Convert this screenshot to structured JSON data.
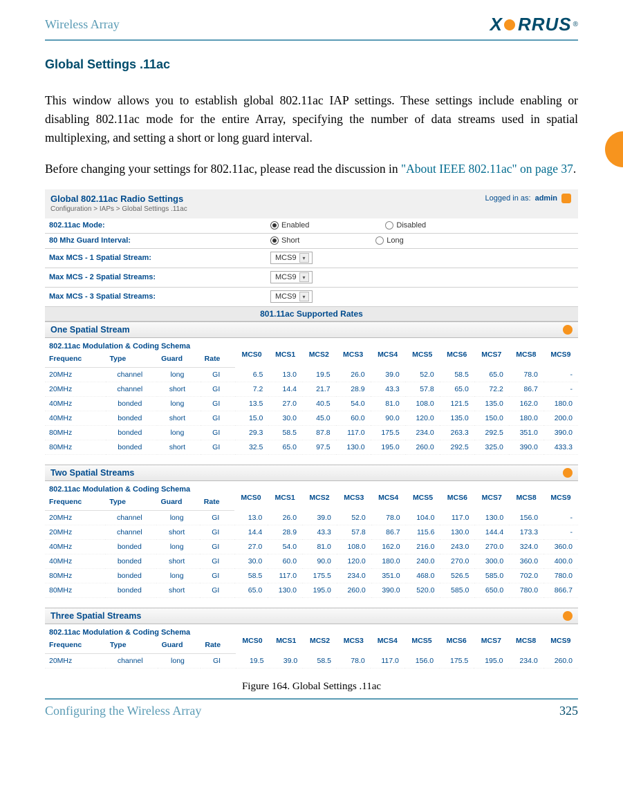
{
  "page": {
    "product_name": "Wireless Array",
    "logo_text": "XIRRUS",
    "section_title": "Global Settings .11ac",
    "para1": "This window allows you to establish global 802.11ac IAP settings. These settings include enabling or disabling 802.11ac mode for the entire Array, specifying the number of data streams used in spatial multiplexing, and setting a short or long guard interval.",
    "para2_pre": "Before changing your settings for 802.11ac, please read the discussion in ",
    "para2_link": "\"About IEEE 802.11ac\" on page 37",
    "para2_post": ".",
    "figure_caption": "Figure 164. Global Settings .11ac",
    "footer_left": "Configuring the Wireless Array",
    "footer_page": "325"
  },
  "panel": {
    "title": "Global 802.11ac Radio Settings",
    "breadcrumb": "Configuration > IAPs > Global Settings .11ac",
    "logged_in_label": "Logged in as:",
    "logged_in_user": "admin",
    "settings": [
      {
        "label": "802.11ac Mode:",
        "type": "radio",
        "opt1": "Enabled",
        "opt2": "Disabled",
        "selected": 1
      },
      {
        "label": "80 Mhz Guard Interval:",
        "type": "radio",
        "opt1": "Short",
        "opt2": "Long",
        "selected": 1
      },
      {
        "label": "Max MCS - 1 Spatial Stream:",
        "type": "select",
        "value": "MCS9"
      },
      {
        "label": "Max MCS - 2 Spatial Streams:",
        "type": "select",
        "value": "MCS9"
      },
      {
        "label": "Max MCS - 3 Spatial Streams:",
        "type": "select",
        "value": "MCS9"
      }
    ],
    "supported_rates_title": "801.11ac Supported Rates",
    "schema_title": "802.11ac Modulation & Coding Schema",
    "row_header_labels": [
      "Frequenc",
      "Type",
      "Guard",
      "Rate"
    ],
    "mcs_headers": [
      "MCS0",
      "MCS1",
      "MCS2",
      "MCS3",
      "MCS4",
      "MCS5",
      "MCS6",
      "MCS7",
      "MCS8",
      "MCS9"
    ],
    "groups": [
      {
        "title": "One Spatial Stream",
        "rows": [
          {
            "freq": "20MHz",
            "type": "channel",
            "guard": "long",
            "rate": "GI",
            "v": [
              "6.5",
              "13.0",
              "19.5",
              "26.0",
              "39.0",
              "52.0",
              "58.5",
              "65.0",
              "78.0",
              "-"
            ]
          },
          {
            "freq": "20MHz",
            "type": "channel",
            "guard": "short",
            "rate": "GI",
            "v": [
              "7.2",
              "14.4",
              "21.7",
              "28.9",
              "43.3",
              "57.8",
              "65.0",
              "72.2",
              "86.7",
              "-"
            ]
          },
          {
            "freq": "40MHz",
            "type": "bonded",
            "guard": "long",
            "rate": "GI",
            "v": [
              "13.5",
              "27.0",
              "40.5",
              "54.0",
              "81.0",
              "108.0",
              "121.5",
              "135.0",
              "162.0",
              "180.0"
            ]
          },
          {
            "freq": "40MHz",
            "type": "bonded",
            "guard": "short",
            "rate": "GI",
            "v": [
              "15.0",
              "30.0",
              "45.0",
              "60.0",
              "90.0",
              "120.0",
              "135.0",
              "150.0",
              "180.0",
              "200.0"
            ]
          },
          {
            "freq": "80MHz",
            "type": "bonded",
            "guard": "long",
            "rate": "GI",
            "v": [
              "29.3",
              "58.5",
              "87.8",
              "117.0",
              "175.5",
              "234.0",
              "263.3",
              "292.5",
              "351.0",
              "390.0"
            ]
          },
          {
            "freq": "80MHz",
            "type": "bonded",
            "guard": "short",
            "rate": "GI",
            "v": [
              "32.5",
              "65.0",
              "97.5",
              "130.0",
              "195.0",
              "260.0",
              "292.5",
              "325.0",
              "390.0",
              "433.3"
            ]
          }
        ]
      },
      {
        "title": "Two Spatial Streams",
        "rows": [
          {
            "freq": "20MHz",
            "type": "channel",
            "guard": "long",
            "rate": "GI",
            "v": [
              "13.0",
              "26.0",
              "39.0",
              "52.0",
              "78.0",
              "104.0",
              "117.0",
              "130.0",
              "156.0",
              "-"
            ]
          },
          {
            "freq": "20MHz",
            "type": "channel",
            "guard": "short",
            "rate": "GI",
            "v": [
              "14.4",
              "28.9",
              "43.3",
              "57.8",
              "86.7",
              "115.6",
              "130.0",
              "144.4",
              "173.3",
              "-"
            ]
          },
          {
            "freq": "40MHz",
            "type": "bonded",
            "guard": "long",
            "rate": "GI",
            "v": [
              "27.0",
              "54.0",
              "81.0",
              "108.0",
              "162.0",
              "216.0",
              "243.0",
              "270.0",
              "324.0",
              "360.0"
            ]
          },
          {
            "freq": "40MHz",
            "type": "bonded",
            "guard": "short",
            "rate": "GI",
            "v": [
              "30.0",
              "60.0",
              "90.0",
              "120.0",
              "180.0",
              "240.0",
              "270.0",
              "300.0",
              "360.0",
              "400.0"
            ]
          },
          {
            "freq": "80MHz",
            "type": "bonded",
            "guard": "long",
            "rate": "GI",
            "v": [
              "58.5",
              "117.0",
              "175.5",
              "234.0",
              "351.0",
              "468.0",
              "526.5",
              "585.0",
              "702.0",
              "780.0"
            ]
          },
          {
            "freq": "80MHz",
            "type": "bonded",
            "guard": "short",
            "rate": "GI",
            "v": [
              "65.0",
              "130.0",
              "195.0",
              "260.0",
              "390.0",
              "520.0",
              "585.0",
              "650.0",
              "780.0",
              "866.7"
            ]
          }
        ]
      },
      {
        "title": "Three Spatial Streams",
        "rows": [
          {
            "freq": "20MHz",
            "type": "channel",
            "guard": "long",
            "rate": "GI",
            "v": [
              "19.5",
              "39.0",
              "58.5",
              "78.0",
              "117.0",
              "156.0",
              "175.5",
              "195.0",
              "234.0",
              "260.0"
            ]
          }
        ]
      }
    ]
  }
}
